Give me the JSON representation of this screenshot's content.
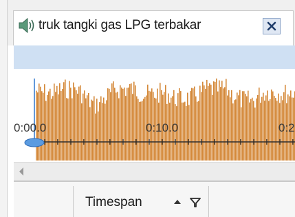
{
  "tab": {
    "title": "truk tangki gas LPG terbakar",
    "icon": "speaker-icon",
    "close_icon": "close-icon"
  },
  "waveform": {
    "time_labels": [
      "0:00.0",
      "0:10.0",
      "0:2"
    ],
    "color": "#d4893a",
    "axis_color": "#2d2d2d",
    "playhead_color": "#3a7fd1"
  },
  "grid": {
    "column_title": "Timespan",
    "sort_icon": "sort-ascending-icon",
    "filter_icon": "filter-icon"
  }
}
